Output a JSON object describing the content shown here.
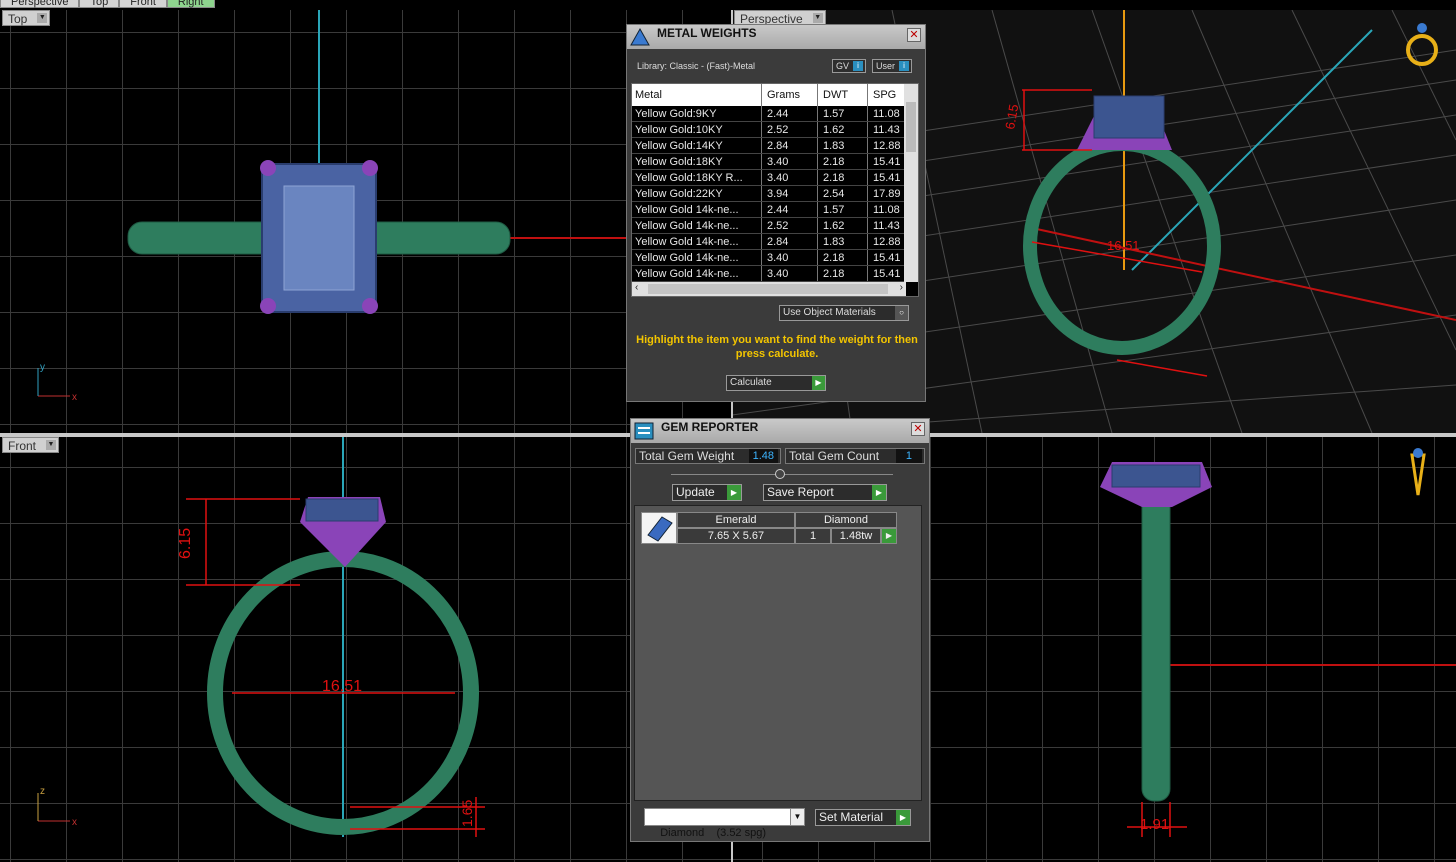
{
  "view_tabs": [
    "Perspective",
    "Top",
    "Front",
    "Right"
  ],
  "active_tab": "Right",
  "viewports": {
    "top": {
      "label": "Top",
      "axis_x": "x",
      "axis_y": "y"
    },
    "perspective": {
      "label": "Perspective",
      "dims": {
        "height": "6.15",
        "width": "16.51",
        "band_a": "1.91",
        "band_b": "1.65"
      }
    },
    "front": {
      "label": "Front",
      "axis_x": "x",
      "axis_y": "z",
      "dims": {
        "height": "6.15",
        "width": "16.51",
        "band": "1.65"
      }
    },
    "right": {
      "dims": {
        "band": "1.91"
      }
    }
  },
  "metal_weights": {
    "title": "METAL WEIGHTS",
    "library": "Library: Classic - (Fast)-Metal",
    "chip_gv": "GV",
    "chip_user": "User",
    "chip_icon": "i",
    "columns": [
      "Metal",
      "Grams",
      "DWT",
      "SPG"
    ],
    "rows": [
      [
        "Yellow Gold:9KY",
        "2.44",
        "1.57",
        "11.08"
      ],
      [
        "Yellow Gold:10KY",
        "2.52",
        "1.62",
        "11.43"
      ],
      [
        "Yellow Gold:14KY",
        "2.84",
        "1.83",
        "12.88"
      ],
      [
        "Yellow Gold:18KY",
        "3.40",
        "2.18",
        "15.41"
      ],
      [
        "Yellow Gold:18KY R...",
        "3.40",
        "2.18",
        "15.41"
      ],
      [
        "Yellow Gold:22KY",
        "3.94",
        "2.54",
        "17.89"
      ],
      [
        "Yellow Gold 14k-ne...",
        "2.44",
        "1.57",
        "11.08"
      ],
      [
        "Yellow Gold 14k-ne...",
        "2.52",
        "1.62",
        "11.43"
      ],
      [
        "Yellow Gold 14k-ne...",
        "2.84",
        "1.83",
        "12.88"
      ],
      [
        "Yellow Gold 14k-ne...",
        "3.40",
        "2.18",
        "15.41"
      ],
      [
        "Yellow Gold 14k-ne...",
        "3.40",
        "2.18",
        "15.41"
      ]
    ],
    "use_object_materials": "Use Object Materials",
    "hint": "Highlight the item you want to find the weight for then press calculate.",
    "calculate": "Calculate"
  },
  "gem_reporter": {
    "title": "GEM REPORTER",
    "total_weight_label": "Total Gem Weight",
    "total_weight": "1.48",
    "total_count_label": "Total Gem Count",
    "total_count": "1",
    "update": "Update",
    "save_report": "Save Report",
    "gem": {
      "shape": "Emerald",
      "size": "7.65 X 5.67",
      "material": "Diamond",
      "count": "1",
      "weight": "1.48tw"
    },
    "material_select": "Diamond    (3.52 spg)",
    "set_material": "Set Material"
  },
  "colors": {
    "ring": "#2e7d5e",
    "prong": "#8a44b8",
    "stone": "#6a85c0",
    "dimension": "#e01010",
    "accent_yellow": "#f3c500",
    "go_green": "#3a9a3a"
  },
  "icons": [
    "metal-weights-icon",
    "gem-reporter-icon",
    "gem-icon",
    "close-icon",
    "ring-gumball-icon"
  ]
}
